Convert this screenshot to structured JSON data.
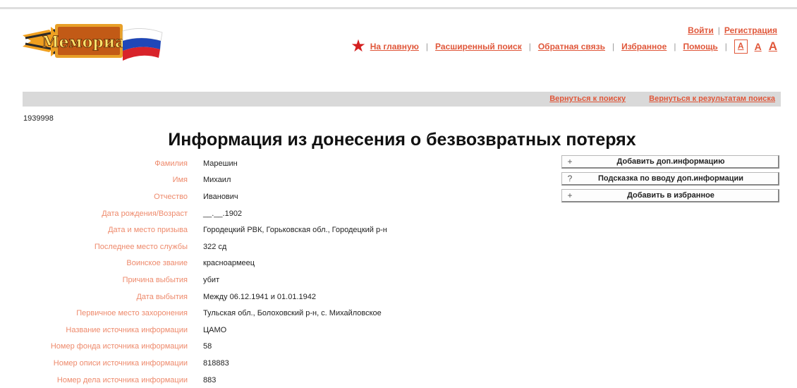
{
  "auth": {
    "login": "Войти",
    "register": "Регистрация"
  },
  "nav": {
    "home": "На главную",
    "advanced_search": "Расширенный поиск",
    "feedback": "Обратная связь",
    "favorites": "Избранное",
    "help": "Помощь",
    "font_small": "A",
    "font_medium": "A",
    "font_large": "A",
    "star_icon": "star-icon"
  },
  "graybar": {
    "back_to_search": "Вернуться к поиску",
    "back_to_results": "Вернуться к результатам поиска"
  },
  "record_id": "1939998",
  "title": "Информация из донесения о безвозвратных потерях",
  "fields": [
    {
      "label": "Фамилия",
      "value": "Марешин"
    },
    {
      "label": "Имя",
      "value": "Михаил"
    },
    {
      "label": "Отчество",
      "value": "Иванович"
    },
    {
      "label": "Дата рождения/Возраст",
      "value": "__.__.1902"
    },
    {
      "label": "Дата и место призыва",
      "value": "Городецкий РВК, Горьковская обл., Городецкий р-н"
    },
    {
      "label": "Последнее место службы",
      "value": "322 сд"
    },
    {
      "label": "Воинское звание",
      "value": "красноармеец"
    },
    {
      "label": "Причина выбытия",
      "value": "убит"
    },
    {
      "label": "Дата выбытия",
      "value": "Между 06.12.1941 и 01.01.1942"
    },
    {
      "label": "Первичное место захоронения",
      "value": "Тульская обл., Болоховский р-н, с. Михайловское"
    },
    {
      "label": "Название источника информации",
      "value": "ЦАМО"
    },
    {
      "label": "Номер фонда источника информации",
      "value": "58"
    },
    {
      "label": "Номер описи источника информации",
      "value": "818883"
    },
    {
      "label": "Номер дела источника информации",
      "value": "883"
    }
  ],
  "actions": [
    {
      "icon": "+",
      "label": "Добавить доп.информацию"
    },
    {
      "icon": "?",
      "label": "Подсказка по вводу доп.информации"
    },
    {
      "icon": "+",
      "label": "Добавить в избранное"
    }
  ],
  "colors": {
    "accent": "#e0573a",
    "label": "#ee8a6c",
    "bar": "#d9d9d9",
    "star": "#d42020"
  }
}
